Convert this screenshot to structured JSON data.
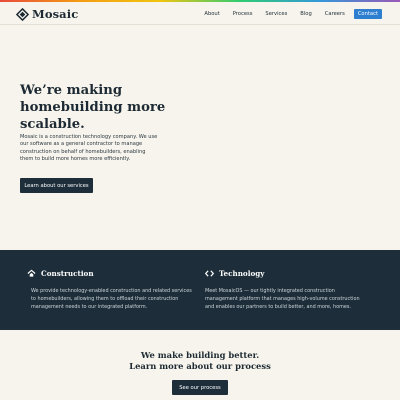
{
  "brand": {
    "name": "Mosaic",
    "accent": "#2f7fd0",
    "dark": "#1d2e3a",
    "background": "#f6f4ec"
  },
  "nav": {
    "items": [
      "About",
      "Process",
      "Services",
      "Blog",
      "Careers"
    ],
    "contact": "Contact"
  },
  "hero": {
    "title_lines": [
      "We’re making",
      "homebuilding more",
      "scalable."
    ],
    "description_lines": [
      "Mosaic is a construction technology company. We use",
      "our software as a general contractor to manage",
      "construction on behalf of homebuilders, enabling",
      "them to build more homes more efficiently."
    ],
    "button": "Learn about our services"
  },
  "features": [
    {
      "icon": "house-icon",
      "title": "Construction",
      "lines": [
        "We provide technology-enabled construction and related services",
        "to homebuilders, allowing them to offload their construction",
        "management needs to our integrated platform."
      ]
    },
    {
      "icon": "code-icon",
      "title": "Technology",
      "lines": [
        "Meet MosaicOS — our tightly integrated construction",
        "management platform that manages high-volume construction",
        "and enables our partners to build better, and more, homes."
      ]
    }
  ],
  "process": {
    "title_lines": [
      "We make building better.",
      "Learn more about our process"
    ],
    "button": "See our process"
  }
}
